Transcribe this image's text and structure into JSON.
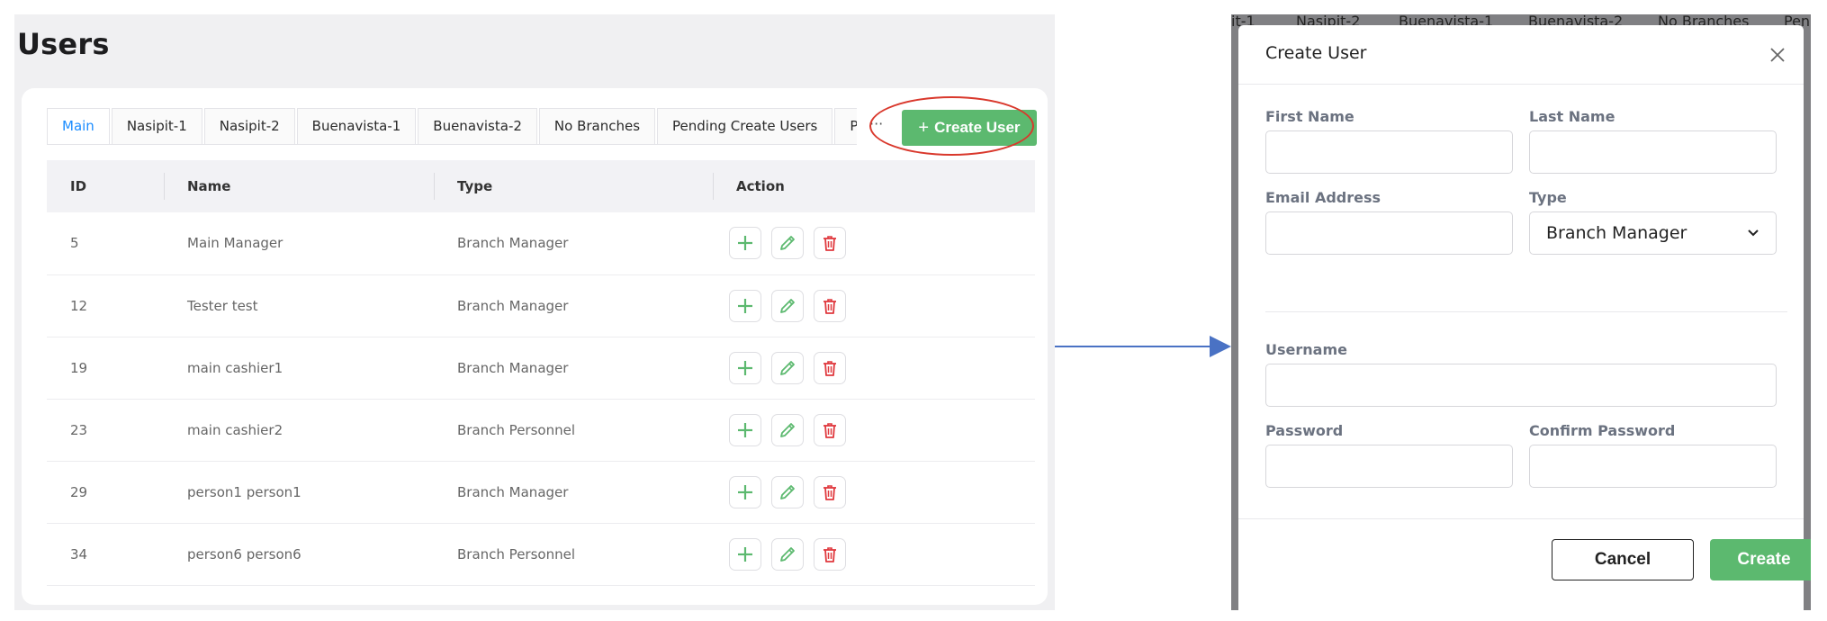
{
  "page": {
    "title": "Users"
  },
  "tabs": [
    {
      "label": "Main",
      "active": true
    },
    {
      "label": "Nasipit-1",
      "active": false
    },
    {
      "label": "Nasipit-2",
      "active": false
    },
    {
      "label": "Buenavista-1",
      "active": false
    },
    {
      "label": "Buenavista-2",
      "active": false
    },
    {
      "label": "No Branches",
      "active": false
    },
    {
      "label": "Pending Create Users",
      "active": false
    },
    {
      "label": "Pending E",
      "active": false
    }
  ],
  "tabs_more_label": "···",
  "toolbar": {
    "create_user_label": "Create User",
    "create_user_icon": "plus-icon"
  },
  "table": {
    "headers": {
      "id": "ID",
      "name": "Name",
      "type": "Type",
      "action": "Action"
    },
    "rows": [
      {
        "id": "5",
        "name": "Main Manager",
        "type": "Branch Manager"
      },
      {
        "id": "12",
        "name": "Tester test",
        "type": "Branch Manager"
      },
      {
        "id": "19",
        "name": "main cashier1",
        "type": "Branch Manager"
      },
      {
        "id": "23",
        "name": "main cashier2",
        "type": "Branch Personnel"
      },
      {
        "id": "29",
        "name": "person1 person1",
        "type": "Branch Manager"
      },
      {
        "id": "34",
        "name": "person6 person6",
        "type": "Branch Personnel"
      }
    ],
    "action_icons": [
      "plus-icon",
      "pencil-icon",
      "trash-icon"
    ]
  },
  "background_tabs": [
    "it-1",
    "Nasipit-2",
    "Buenavista-1",
    "Buenavista-2",
    "No Branches",
    "Pen"
  ],
  "modal": {
    "title": "Create User",
    "close_icon": "close-icon",
    "fields": {
      "first_name": {
        "label": "First Name",
        "value": ""
      },
      "last_name": {
        "label": "Last Name",
        "value": ""
      },
      "email": {
        "label": "Email Address",
        "value": ""
      },
      "type": {
        "label": "Type",
        "value": "Branch Manager"
      },
      "username": {
        "label": "Username",
        "value": ""
      },
      "password": {
        "label": "Password",
        "value": ""
      },
      "confirm_password": {
        "label": "Confirm Password",
        "value": ""
      }
    },
    "cancel_label": "Cancel",
    "create_label": "Create"
  },
  "colors": {
    "accent_green": "#5cb96f",
    "active_tab_blue": "#1b8cff",
    "delete_red": "#e0393e",
    "highlight_red": "#d9382c",
    "arrow_blue": "#4a72c4"
  }
}
